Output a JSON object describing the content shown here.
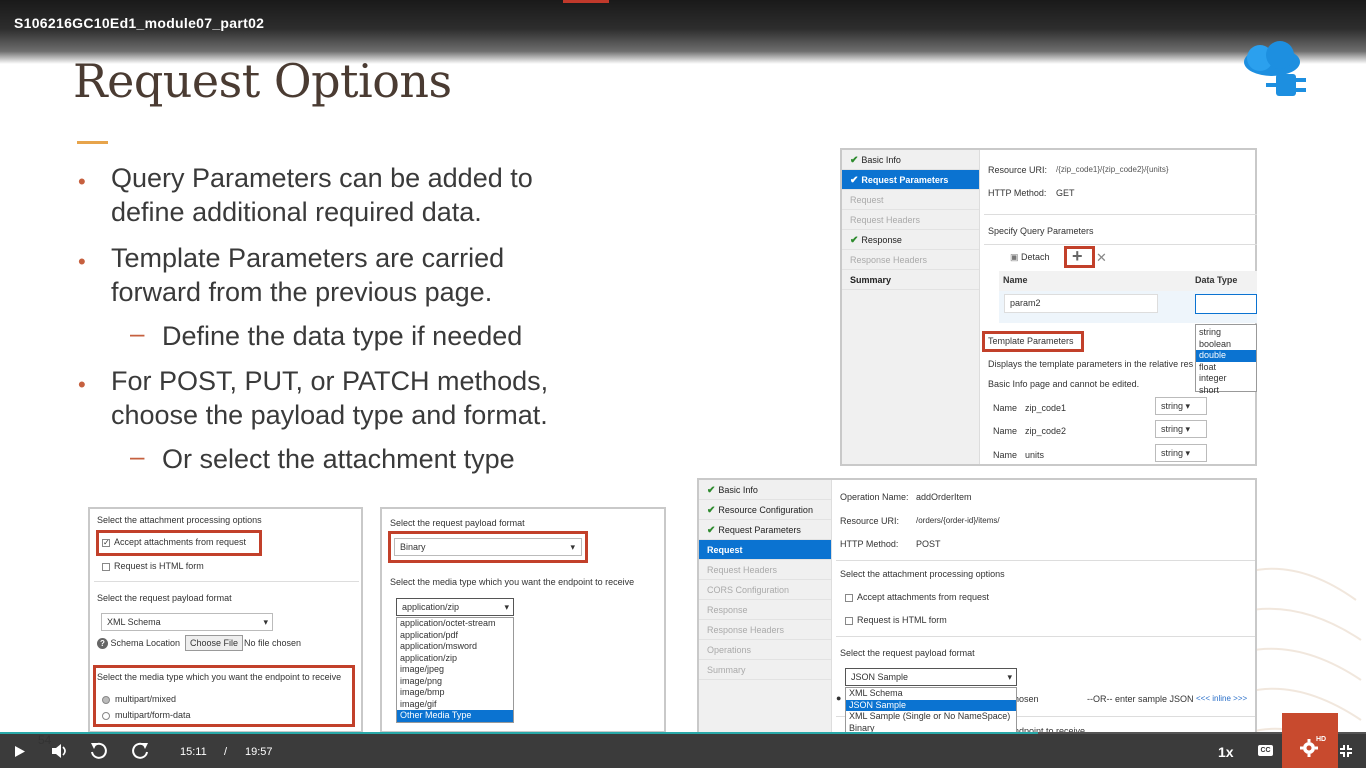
{
  "player": {
    "video_title": "S106216GC10Ed1_module07_part02",
    "current_time": "15:11",
    "separator": "/",
    "duration": "19:57",
    "speed": "1x",
    "quality_badge": "HD",
    "slide_number": "54",
    "progress_fraction": 0.76
  },
  "slide": {
    "title": "Request Options",
    "bullets": [
      {
        "line1": "Query Parameters can be added to",
        "line2": "define additional required data."
      },
      {
        "line1": "Template Parameters are carried",
        "line2": "forward from the previous page."
      },
      {
        "sub": "Define the data type if needed"
      },
      {
        "line1": "For POST, PUT, or PATCH methods,",
        "line2": "choose the payload type and format."
      },
      {
        "sub": "Or select the attachment type"
      }
    ]
  },
  "panel_query": {
    "sidebar": [
      "Basic Info",
      "Request Parameters",
      "Request",
      "Request Headers",
      "Response",
      "Response Headers",
      "Summary"
    ],
    "resource_uri_label": "Resource URI:",
    "resource_uri": "/{zip_code1}/{zip_code2}/{units}",
    "http_method_label": "HTTP Method:",
    "http_method": "GET",
    "query_section": "Specify Query Parameters",
    "detach": "Detach",
    "add_icon": "+",
    "delete_icon": "✕",
    "col_name": "Name",
    "col_type": "Data Type",
    "param_value": "param2",
    "type_options": [
      "string",
      "boolean",
      "double",
      "float",
      "integer",
      "short"
    ],
    "type_selected": "double",
    "template_title": "Template Parameters",
    "template_desc1": "Displays the template parameters in the relative res",
    "template_desc2": "Basic Info page and cannot be edited.",
    "name_label": "Name",
    "template_params": [
      {
        "name": "zip_code1",
        "type": "string"
      },
      {
        "name": "zip_code2",
        "type": "string"
      },
      {
        "name": "units",
        "type": "string"
      }
    ]
  },
  "panel_attach": {
    "title": "Select the attachment processing options",
    "accept": "Accept attachments from request",
    "html_form": "Request is HTML form",
    "payload_title": "Select the request payload format",
    "payload_value": "XML Schema",
    "schema_location": "Schema Location",
    "choose_file": "Choose File",
    "no_file": "No file chosen",
    "media_title": "Select the media type which you want the endpoint to receive",
    "media_options": [
      "multipart/mixed",
      "multipart/form-data"
    ]
  },
  "panel_payload": {
    "title": "Select the request payload format",
    "value": "Binary",
    "media_title": "Select the media type which you want the endpoint to receive",
    "media_value": "application/zip",
    "media_options": [
      "application/octet-stream",
      "application/pdf",
      "application/msword",
      "application/zip",
      "image/jpeg",
      "image/png",
      "image/bmp",
      "image/gif",
      "Other Media Type"
    ],
    "media_selected": "Other Media Type"
  },
  "panel_post": {
    "sidebar": [
      "Basic Info",
      "Resource Configuration",
      "Request Parameters",
      "Request",
      "Request Headers",
      "CORS Configuration",
      "Response",
      "Response Headers",
      "Operations",
      "Summary"
    ],
    "op_label": "Operation Name:",
    "op_value": "addOrderItem",
    "uri_label": "Resource URI:",
    "uri_value": "/orders/{order-id}/items/",
    "method_label": "HTTP Method:",
    "method_value": "POST",
    "attach_title": "Select the attachment processing options",
    "accept": "Accept attachments from request",
    "html_form": "Request is HTML form",
    "payload_title": "Select the request payload format",
    "payload_value": "JSON Sample",
    "payload_options": [
      "XML Schema",
      "JSON Sample",
      "XML Sample (Single or No NameSpace)",
      "Binary"
    ],
    "payload_selected": "JSON Sample",
    "hosen": "hosen",
    "or_text": "--OR-- enter sample JSON",
    "inline_link": "<<< inline >>>",
    "cut_text": "ndpoint to receive"
  }
}
